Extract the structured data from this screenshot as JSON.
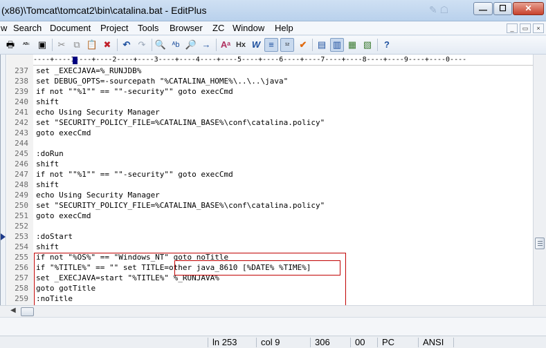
{
  "window": {
    "title": "(x86)\\Tomcat\\tomcat2\\bin\\catalina.bat - EditPlus",
    "min_glyph": "—",
    "max_glyph": "☐",
    "close_glyph": "✕"
  },
  "menu": {
    "items": [
      "w",
      "Search",
      "Document",
      "Project",
      "Tools",
      "Browser",
      "ZC",
      "Window",
      "Help"
    ],
    "mdi_min": "_",
    "mdi_restore": "▭",
    "mdi_close": "×"
  },
  "toolbar": {
    "icons": [
      "print-icon",
      "spellcheck-icon",
      "preview-icon",
      "cut-icon",
      "copy-icon",
      "paste-icon",
      "delete-icon",
      "undo-icon",
      "redo-icon",
      "find-icon",
      "replace-icon",
      "find-in-files-icon",
      "goto-icon",
      "font-icon",
      "html-icon",
      "word-wrap-icon",
      "line-number-icon",
      "ruler-icon",
      "spellcheck-check-icon",
      "cliptext-icon",
      "directory-icon",
      "output-icon",
      "browser-icon",
      "help-icon"
    ],
    "glyphs": [
      "🖶",
      "ᴬᴮᶜ",
      "▣",
      "✂",
      "⧉",
      "📋",
      "✖",
      "↶",
      "↷",
      "🔍",
      "ᴬb",
      "🔎",
      "→",
      "Aᵃ",
      "Hx",
      "W",
      "≡",
      "¹²",
      "✔",
      "▤",
      "▥",
      "▦",
      "▧",
      "?"
    ]
  },
  "ruler": {
    "text": "----+----1----+----2----+----3----+----4----+----5----+----6----+----7----+----8----+----9----+----0----"
  },
  "editor": {
    "lines": [
      {
        "n": "237",
        "text": "set _EXECJAVA=%_RUNJDB%"
      },
      {
        "n": "238",
        "text": "set DEBUG_OPTS=-sourcepath \"%CATALINA_HOME%\\..\\..\\java\""
      },
      {
        "n": "239",
        "text": "if not \"\"%1\"\" == \"\"-security\"\" goto execCmd"
      },
      {
        "n": "240",
        "text": "shift"
      },
      {
        "n": "241",
        "text": "echo Using Security Manager"
      },
      {
        "n": "242",
        "text": "set \"SECURITY_POLICY_FILE=%CATALINA_BASE%\\conf\\catalina.policy\""
      },
      {
        "n": "243",
        "text": "goto execCmd"
      },
      {
        "n": "244",
        "text": ""
      },
      {
        "n": "245",
        "text": ":doRun"
      },
      {
        "n": "246",
        "text": "shift"
      },
      {
        "n": "247",
        "text": "if not \"\"%1\"\" == \"\"-security\"\" goto execCmd"
      },
      {
        "n": "248",
        "text": "shift"
      },
      {
        "n": "249",
        "text": "echo Using Security Manager"
      },
      {
        "n": "250",
        "text": "set \"SECURITY_POLICY_FILE=%CATALINA_BASE%\\conf\\catalina.policy\""
      },
      {
        "n": "251",
        "text": "goto execCmd"
      },
      {
        "n": "252",
        "text": ""
      },
      {
        "n": "253",
        "text": ":doStart"
      },
      {
        "n": "254",
        "text": "shift"
      },
      {
        "n": "255",
        "text": "if not \"%OS%\" == \"Windows_NT\" goto noTitle"
      },
      {
        "n": "256",
        "text": "if \"%TITLE%\" == \"\" set TITLE=other java_8610 [%DATE% %TIME%]"
      },
      {
        "n": "257",
        "text": "set _EXECJAVA=start \"%TITLE%\" %_RUNJAVA%"
      },
      {
        "n": "258",
        "text": "goto gotTitle"
      },
      {
        "n": "259",
        "text": ":noTitle"
      }
    ]
  },
  "status": {
    "ln": "ln 253",
    "col": "col 9",
    "count": "306",
    "code": "00",
    "mode": "PC",
    "encoding": "ANSI"
  },
  "colors": {
    "highlight_box": "#c00000",
    "bookmark": "#1e3a8a"
  }
}
